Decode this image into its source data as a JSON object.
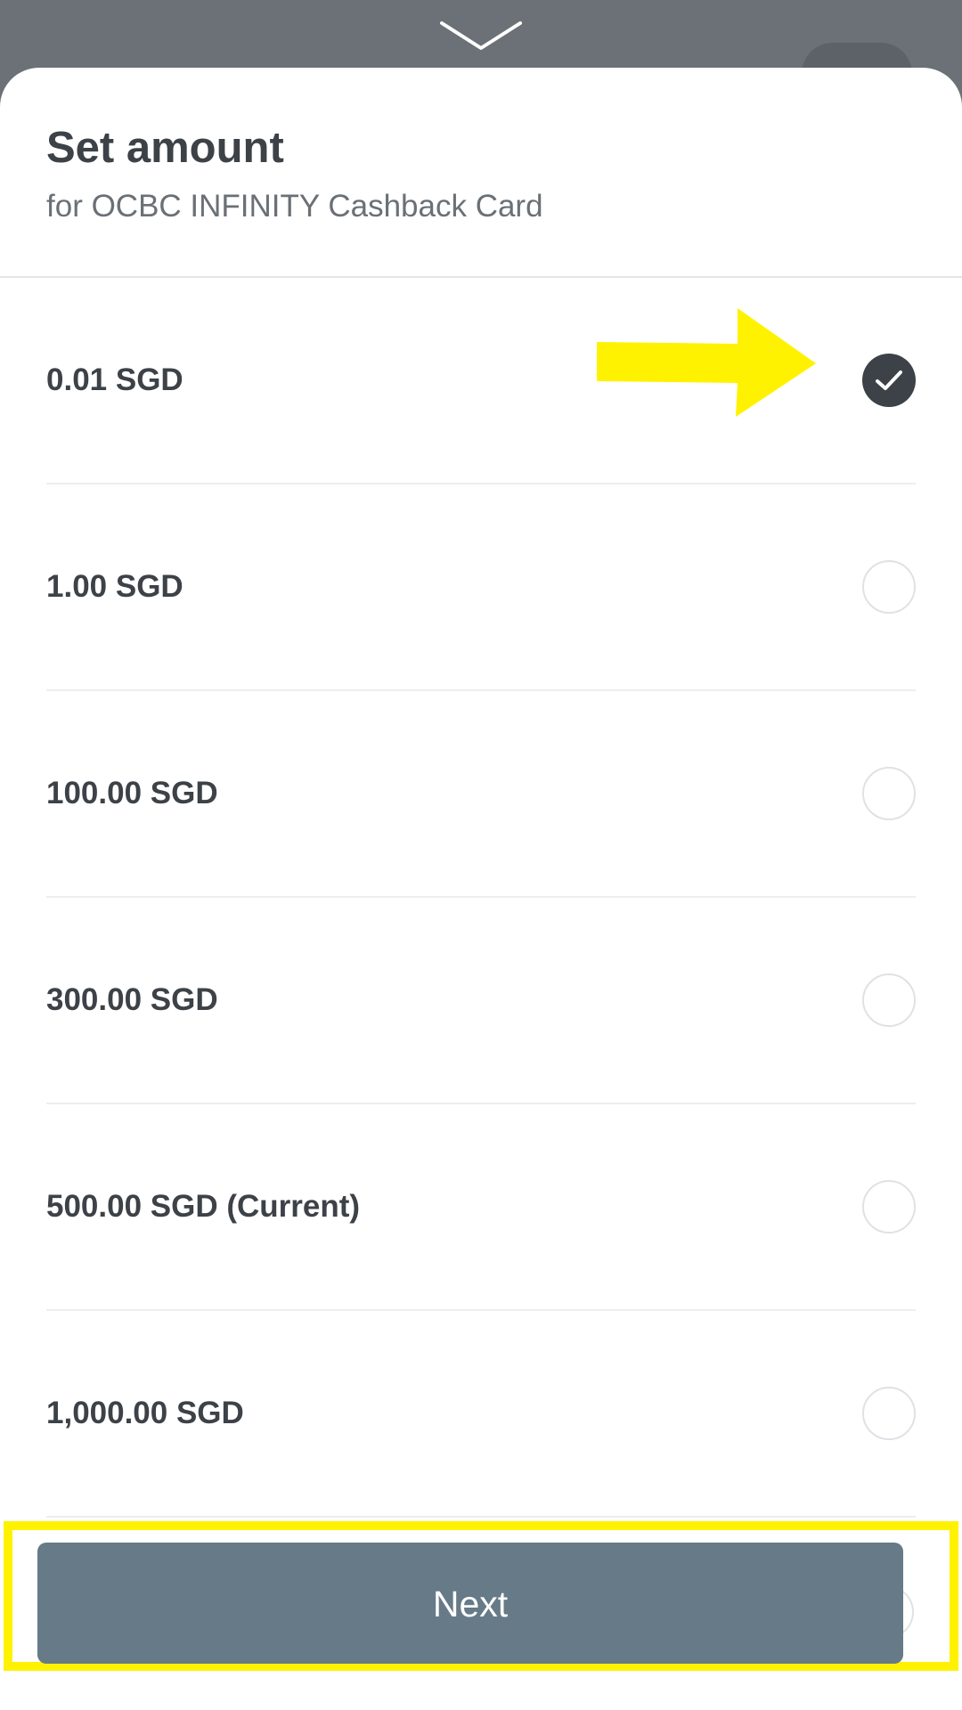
{
  "header": {
    "title": "Set amount",
    "subtitle": "for OCBC INFINITY Cashback Card"
  },
  "options": [
    {
      "label": "0.01 SGD",
      "selected": true
    },
    {
      "label": "1.00 SGD",
      "selected": false
    },
    {
      "label": "100.00 SGD",
      "selected": false
    },
    {
      "label": "300.00 SGD",
      "selected": false
    },
    {
      "label": "500.00 SGD (Current)",
      "selected": false
    },
    {
      "label": "1,000.00 SGD",
      "selected": false
    }
  ],
  "footer": {
    "next_label": "Next"
  },
  "icons": {
    "collapse": "chevron-down-icon",
    "selected": "checkmark-icon",
    "annotation": "arrow-right-icon"
  },
  "colors": {
    "backdrop": "#6b7176",
    "next_button": "#667a87",
    "selected_radio": "#3c4247",
    "highlight": "#fff200"
  }
}
